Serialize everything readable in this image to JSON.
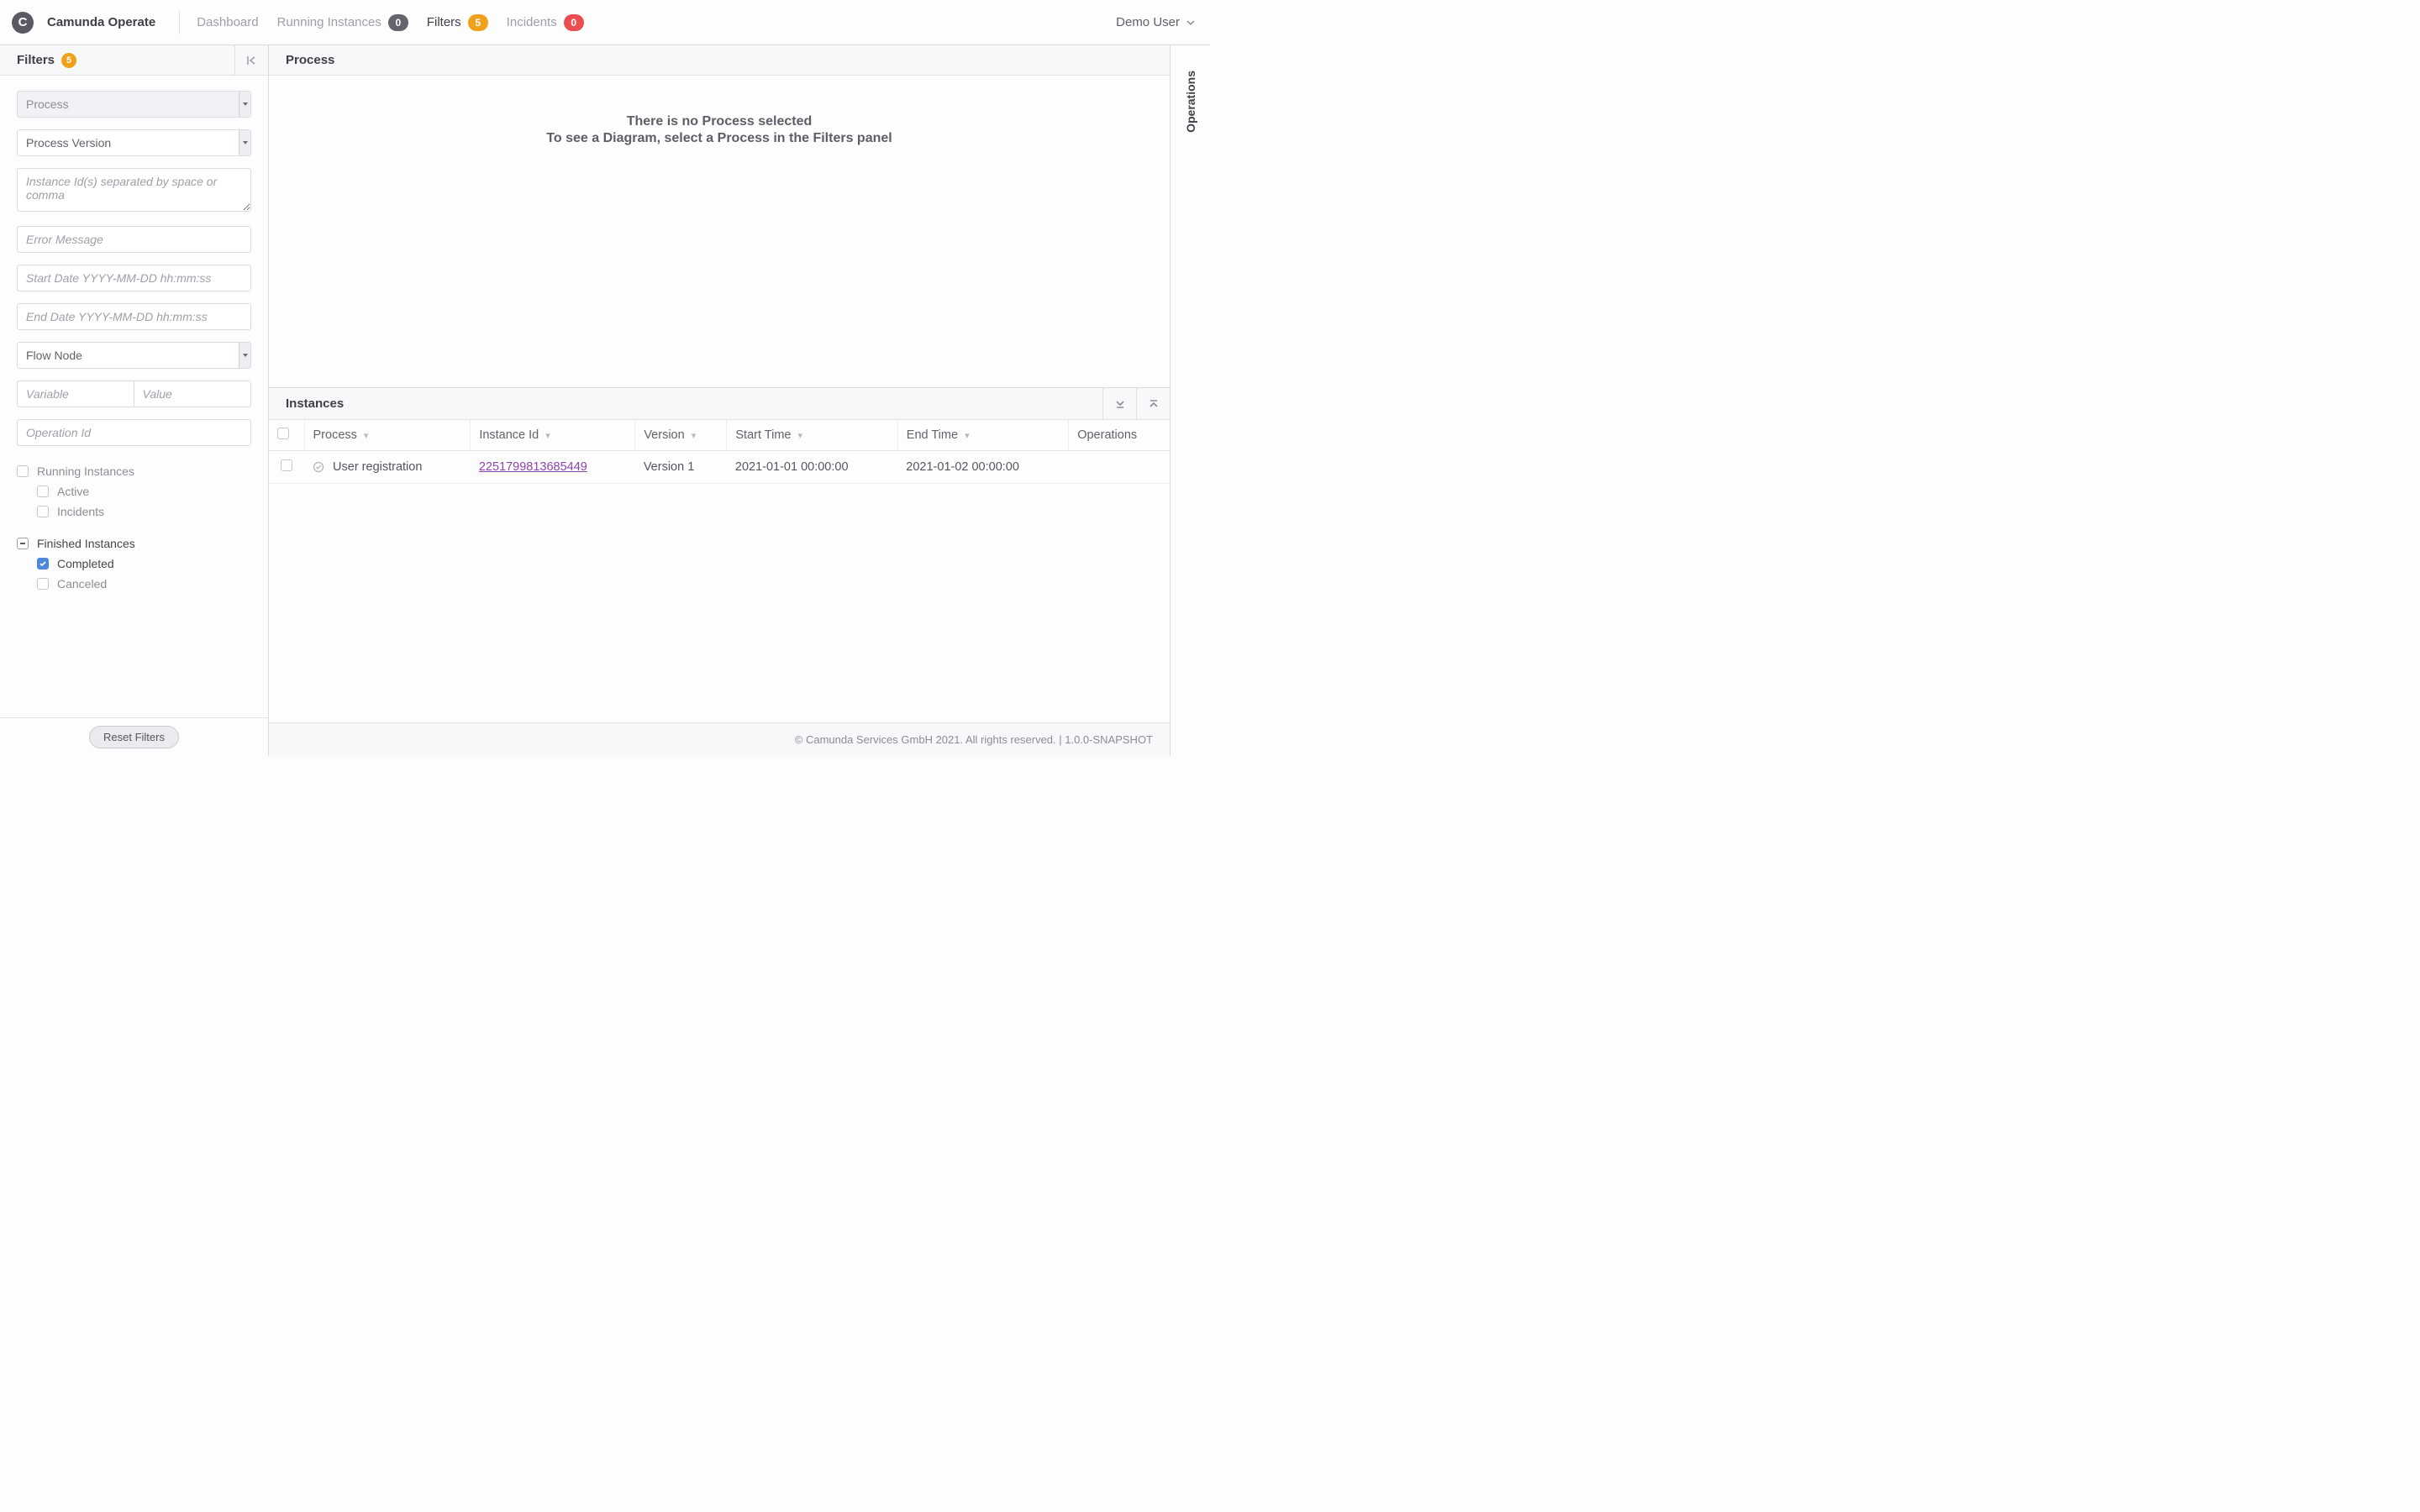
{
  "app": {
    "logo_letter": "C",
    "title": "Camunda Operate"
  },
  "nav": {
    "dashboard": "Dashboard",
    "running": {
      "label": "Running Instances",
      "count": "0"
    },
    "filters": {
      "label": "Filters",
      "count": "5"
    },
    "incidents": {
      "label": "Incidents",
      "count": "0"
    }
  },
  "user": {
    "name": "Demo User"
  },
  "sidebar": {
    "title": "Filters",
    "count": "5",
    "process_select": "Process",
    "version_select": "Process Version",
    "instance_ids_ph": "Instance Id(s) separated by space or comma",
    "error_ph": "Error Message",
    "start_ph": "Start Date YYYY-MM-DD hh:mm:ss",
    "end_ph": "End Date YYYY-MM-DD hh:mm:ss",
    "flownode_select": "Flow Node",
    "variable_ph": "Variable",
    "value_ph": "Value",
    "operation_ph": "Operation Id",
    "running_instances": "Running Instances",
    "active": "Active",
    "incidents": "Incidents",
    "finished_instances": "Finished Instances",
    "completed": "Completed",
    "canceled": "Canceled",
    "reset": "Reset Filters"
  },
  "content": {
    "process_header": "Process",
    "empty_line1": "There is no Process selected",
    "empty_line2": "To see a Diagram, select a Process in the Filters panel",
    "instances_header": "Instances",
    "columns": {
      "process": "Process",
      "instance_id": "Instance Id",
      "version": "Version",
      "start": "Start Time",
      "end": "End Time",
      "operations": "Operations"
    },
    "rows": [
      {
        "process": "User registration",
        "instance_id": "2251799813685449",
        "version": "Version 1",
        "start": "2021-01-01 00:00:00",
        "end": "2021-01-02 00:00:00"
      }
    ]
  },
  "ops_panel": "Operations",
  "footer": "© Camunda Services GmbH 2021. All rights reserved. | 1.0.0-SNAPSHOT"
}
